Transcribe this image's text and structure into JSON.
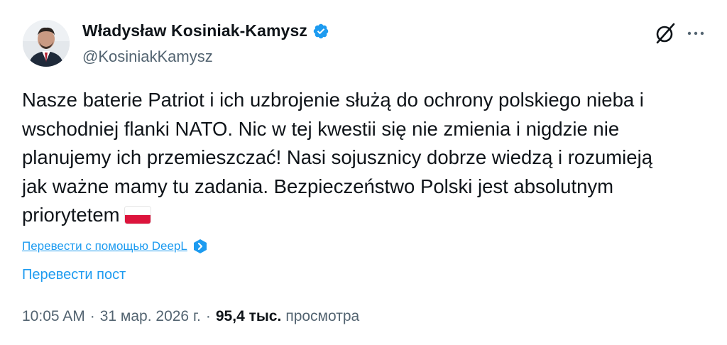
{
  "author": {
    "name": "Władysław Kosiniak-Kamysz",
    "handle": "@KosiniakKamysz",
    "avatar": "avatar-photo",
    "verified_icon": "verified-badge-icon"
  },
  "actions": {
    "grok_icon": "grok-icon",
    "more_icon": "more-options-icon"
  },
  "tweet": {
    "text": "Nasze baterie Patriot i ich uzbrojenie służą do ochrony polskiego nieba i\nwschodniej flanki NATO. Nic w tej kwestii się nie zmienia i nigdzie nie\nplanujemy ich przemieszczać! Nasi sojusznicy dobrze wiedzą i rozumieją\njak ważne mamy tu zadania. Bezpieczeństwo Polski jest absolutnym\npriorytetem",
    "flag": "poland-flag-emoji"
  },
  "translation": {
    "deepl_link": "Перевести с помощью DeepL",
    "translate_post": "Перевести пост"
  },
  "meta": {
    "time": "10:05 AM",
    "separator": "·",
    "date": "31 мар. 2026 г.",
    "views_count": "95,4 тыс.",
    "views_label": "просмотра"
  },
  "colors": {
    "accent": "#1d9bf0",
    "text": "#0f1419",
    "secondary": "#536471",
    "flag_red": "#dc143c"
  }
}
